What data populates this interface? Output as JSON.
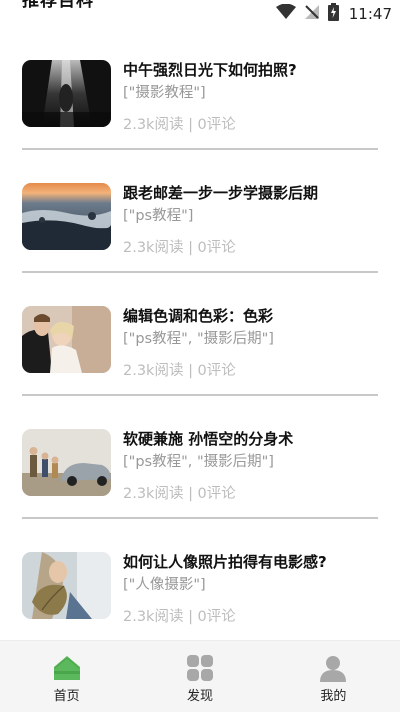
{
  "header": {
    "clipped_title": "推荐百科"
  },
  "status_bar": {
    "time": "11:47",
    "icons": [
      "wifi-icon",
      "no-signal-icon",
      "battery-charging-icon"
    ]
  },
  "articles": [
    {
      "title": "中午强烈日光下如何拍照?",
      "tags": "[\"摄影教程\"]",
      "meta": "2.3k阅读 | 0评论",
      "thumb_icon": "waterfall-photo"
    },
    {
      "title": "跟老邮差一步一步学摄影后期",
      "tags": "[\"ps教程\"]",
      "meta": "2.3k阅读 | 0评论",
      "thumb_icon": "misty-landscape-photo"
    },
    {
      "title": "编辑色调和色彩：色彩",
      "tags": "[\"ps教程\", \"摄影后期\"]",
      "meta": "2.3k阅读 | 0评论",
      "thumb_icon": "wedding-couple-photo"
    },
    {
      "title": "软硬兼施 孙悟空的分身术",
      "tags": "[\"ps教程\", \"摄影后期\"]",
      "meta": "2.3k阅读 | 0评论",
      "thumb_icon": "people-with-car-photo"
    },
    {
      "title": "如何让人像照片拍得有电影感?",
      "tags": "[\"人像摄影\"]",
      "meta": "2.3k阅读 | 0评论",
      "thumb_icon": "portrait-leaf-photo"
    }
  ],
  "bottom_nav": [
    {
      "label": "首页",
      "icon": "home-icon",
      "active": true
    },
    {
      "label": "发现",
      "icon": "grid-icon",
      "active": false
    },
    {
      "label": "我的",
      "icon": "profile-icon",
      "active": false
    }
  ],
  "colors": {
    "accent": "#5cb85c",
    "inactive_icon": "#a8a8a8",
    "tag": "#999999",
    "meta": "#bdbdbd",
    "divider": "#c8c8c8"
  }
}
